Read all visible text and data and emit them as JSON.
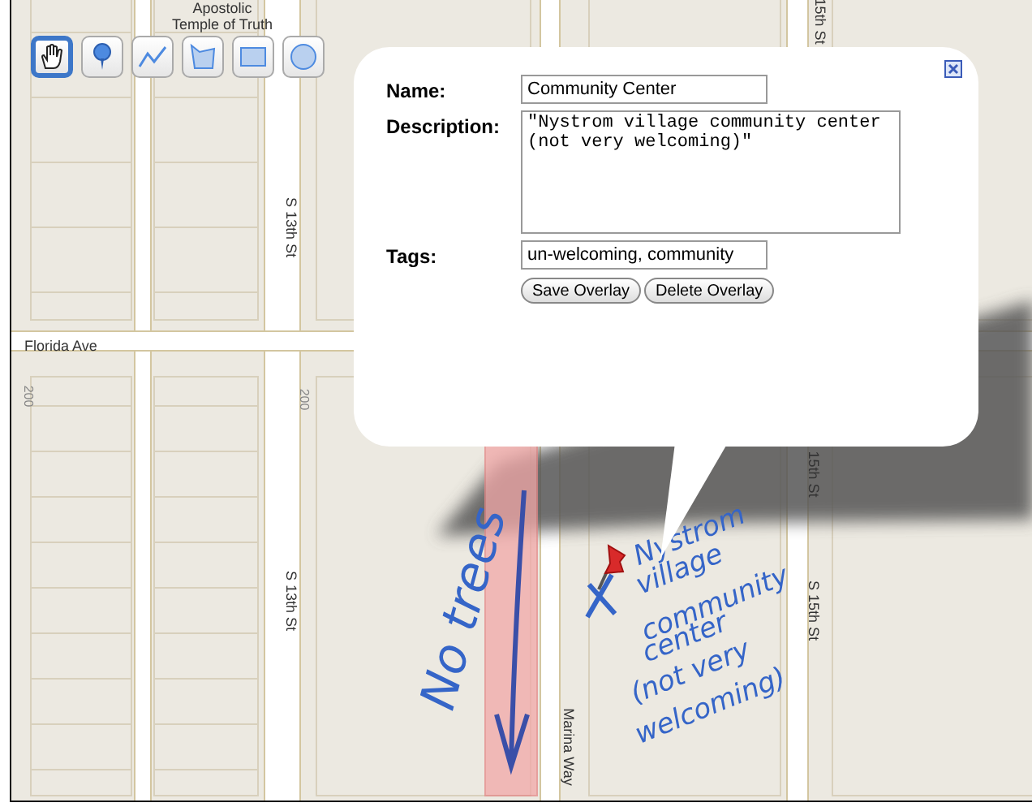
{
  "toolbar": [
    {
      "kind": "hand",
      "selected": true
    },
    {
      "kind": "marker",
      "selected": false
    },
    {
      "kind": "line",
      "selected": false
    },
    {
      "kind": "shape",
      "selected": false
    },
    {
      "kind": "rectangle",
      "selected": false
    },
    {
      "kind": "circle",
      "selected": false
    }
  ],
  "map_labels": [
    {
      "text": "Apostolic",
      "kind": "place"
    },
    {
      "text": "Temple of Truth",
      "kind": "place"
    },
    {
      "text": "Florida Ave",
      "kind": "street"
    },
    {
      "text": "S 13th St",
      "kind": "vertical"
    },
    {
      "text": "S 13th St",
      "kind": "vertical"
    },
    {
      "text": "200",
      "kind": "number"
    },
    {
      "text": "200",
      "kind": "number"
    },
    {
      "text": "15th St",
      "kind": "vertical"
    },
    {
      "text": "15th St",
      "kind": "vertical"
    },
    {
      "text": "S 15th St",
      "kind": "vertical"
    },
    {
      "text": "Marina Way",
      "kind": "vertical"
    }
  ],
  "annotations": [
    {
      "text": "No trees",
      "kind": "vertical"
    },
    {
      "text": "Nystrom",
      "kind": "line"
    },
    {
      "text": "village",
      "kind": "line"
    },
    {
      "text": "community",
      "kind": "line"
    },
    {
      "text": "center",
      "kind": "line"
    },
    {
      "text": "(not very",
      "kind": "line"
    },
    {
      "text": "welcoming)",
      "kind": "line"
    }
  ],
  "popup": {
    "fields": [
      {
        "label": "Name:",
        "kind": "text",
        "value": "Community Center"
      },
      {
        "label": "Description:",
        "kind": "textarea",
        "value": "\"Nystrom village community center (not very welcoming)\""
      },
      {
        "label": "Tags:",
        "kind": "text",
        "value": "un-welcoming, community"
      }
    ],
    "buttons": [
      "Save Overlay",
      "Delete Overlay"
    ]
  }
}
